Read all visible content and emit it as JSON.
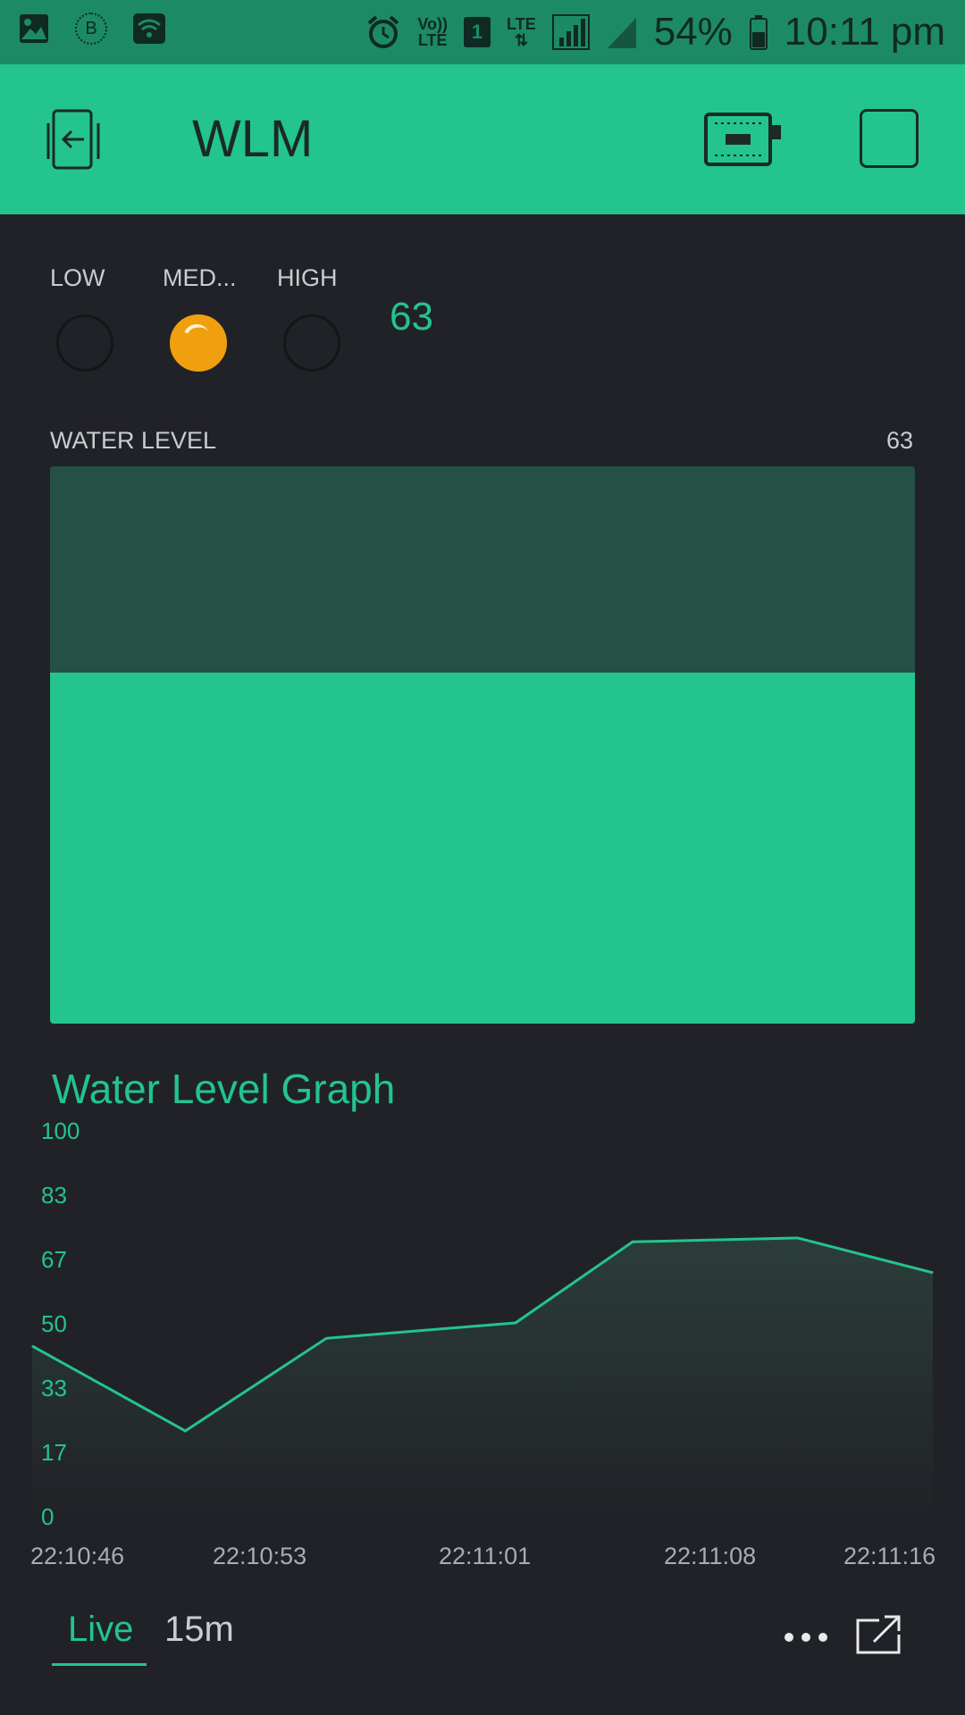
{
  "status_bar": {
    "battery": "54%",
    "time": "10:11 pm",
    "volte_line1": "Vo))",
    "volte_line2": "LTE",
    "lte_label": "LTE",
    "sim_number": "1",
    "bt_label": "B",
    "icons": [
      "image-icon",
      "bluetooth-icon",
      "wifi-icon",
      "alarm-icon",
      "volte-icon",
      "sim-icon",
      "lte-icon",
      "signal-icon",
      "signal-icon",
      "battery-icon"
    ]
  },
  "app_bar": {
    "title": "WLM",
    "icons": [
      "back-icon",
      "device-icon",
      "square-icon"
    ]
  },
  "leds": [
    {
      "label": "LOW",
      "on": false
    },
    {
      "label": "MED...",
      "on": true
    },
    {
      "label": "HIGH",
      "on": false
    }
  ],
  "value_display": "63",
  "level": {
    "label": "WATER LEVEL",
    "value_text": "63",
    "fill_fraction": 0.63
  },
  "graph": {
    "title": "Water Level Graph",
    "tabs": {
      "live": "Live",
      "range": "15m"
    },
    "icons": [
      "more-icon",
      "export-icon"
    ]
  },
  "colors": {
    "accent": "#23c48e",
    "background": "#212227",
    "status_bar": "#1d8a66",
    "led_on": "#f0a00e",
    "level_track": "#245046"
  },
  "chart_data": {
    "type": "area",
    "title": "Water Level Graph",
    "x_ticks": [
      "22:10:46",
      "22:10:53",
      "22:11:01",
      "22:11:08",
      "22:11:16"
    ],
    "y_ticks": [
      "100",
      "83",
      "67",
      "50",
      "33",
      "17",
      "0"
    ],
    "ylim": [
      0,
      100
    ],
    "x_seconds": [
      0,
      30
    ],
    "points": [
      {
        "t": 0,
        "y": 44
      },
      {
        "t": 5.1,
        "y": 22
      },
      {
        "t": 9.8,
        "y": 46
      },
      {
        "t": 16.1,
        "y": 50
      },
      {
        "t": 20.0,
        "y": 71
      },
      {
        "t": 25.5,
        "y": 72
      },
      {
        "t": 30,
        "y": 63
      }
    ],
    "grid": false
  }
}
